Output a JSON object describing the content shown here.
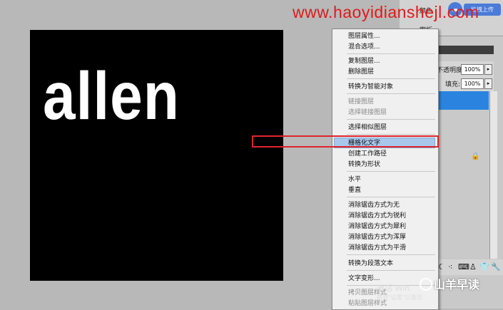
{
  "watermark": "www.haoyidianshejl.com",
  "canvas_text": "allen",
  "blue_button": "拖拽上传",
  "top_panel": {
    "item1": "颜色",
    "item2": "案板"
  },
  "layers_panel": {
    "opacity_label": "不透明度:",
    "opacity_value": "100%",
    "fill_label": "填充:",
    "fill_value": "100%"
  },
  "context_menu": {
    "items": [
      {
        "label": "图层属性...",
        "disabled": false
      },
      {
        "label": "混合选项...",
        "disabled": false
      },
      {
        "label": "复制图层...",
        "disabled": false
      },
      {
        "label": "删除图层",
        "disabled": false
      },
      {
        "label": "转换为智能对象",
        "disabled": false
      },
      {
        "label": "链接图层",
        "disabled": true
      },
      {
        "label": "选择链接图层",
        "disabled": true
      },
      {
        "label": "选择相似图层",
        "disabled": false
      },
      {
        "label": "栅格化文字",
        "disabled": false,
        "highlighted": true
      },
      {
        "label": "创建工作路径",
        "disabled": false
      },
      {
        "label": "转换为形状",
        "disabled": false
      },
      {
        "label": "水平",
        "disabled": false
      },
      {
        "label": "垂直",
        "disabled": false
      },
      {
        "label": "消除锯齿方式为无",
        "disabled": false
      },
      {
        "label": "消除锯齿方式为锐利",
        "disabled": false
      },
      {
        "label": "消除锯齿方式为犀利",
        "disabled": false
      },
      {
        "label": "消除锯齿方式为浑厚",
        "disabled": false
      },
      {
        "label": "消除锯齿方式为平滑",
        "disabled": false
      },
      {
        "label": "转换为段落文本",
        "disabled": false
      },
      {
        "label": "文字变形...",
        "disabled": false
      },
      {
        "label": "拷贝图层样式",
        "disabled": true
      },
      {
        "label": "粘贴图层样式",
        "disabled": true
      }
    ]
  },
  "activation": {
    "line1": "激活 Win",
    "line2": "转到\"设置\"以激活"
  },
  "wechat_badge": "山羊早读",
  "colors": {
    "highlight": "#a7c8ec",
    "red_annotation": "#e0242b",
    "watermark": "#e01a1a",
    "layer_selected": "#2a84df"
  }
}
